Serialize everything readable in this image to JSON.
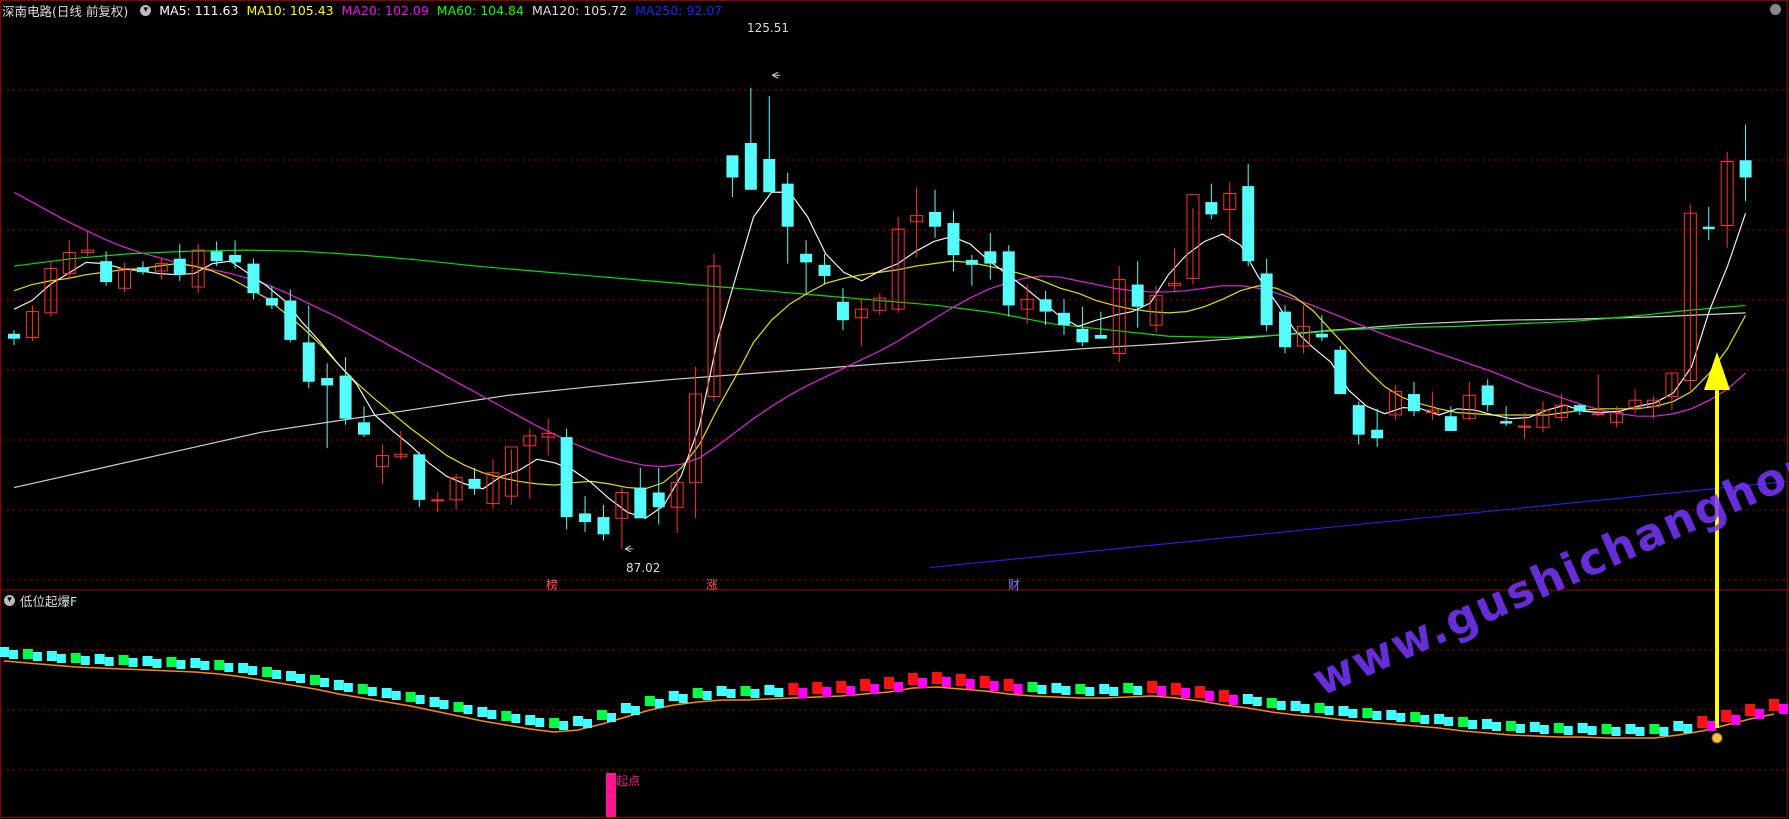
{
  "header": {
    "stock": "深南电路(日线 前复权)",
    "ma": [
      {
        "label": "MA5: 111.63",
        "color": "#ffffff"
      },
      {
        "label": "MA10: 105.43",
        "color": "#ffff00"
      },
      {
        "label": "MA20: 102.09",
        "color": "#ff00ff"
      },
      {
        "label": "MA60: 104.84",
        "color": "#00ff00"
      },
      {
        "label": "MA120: 105.72",
        "color": "#dddddd"
      },
      {
        "label": "MA250: 92.07",
        "color": "#0000ff"
      }
    ]
  },
  "sub_panel": {
    "title": "低位起爆F"
  },
  "markers": {
    "max_label": "125.51",
    "min_label": "87.02",
    "bang_label": "榜",
    "zhang_label": "涨",
    "cai_label": "财",
    "qi_label": "起点"
  },
  "watermark": "www.gushichanghong.com",
  "colors": {
    "up": "#ff3030",
    "down": "#54fcfc",
    "grid": "#8b0000",
    "arrow": "#ffff00"
  },
  "chart_data": {
    "type": "candlestick",
    "ylim": [
      84,
      130
    ],
    "max_price": 125.51,
    "min_price": 87.02,
    "candles": [
      [
        104.5,
        104.8,
        103.6,
        104.1
      ],
      [
        104.2,
        106.8,
        103.9,
        106.3
      ],
      [
        106.2,
        110.3,
        105.9,
        109.8
      ],
      [
        109.4,
        112.1,
        108.9,
        111.1
      ],
      [
        111.1,
        112.8,
        110.8,
        111.3
      ],
      [
        110.4,
        111.2,
        108.4,
        108.7
      ],
      [
        108.2,
        110.3,
        107.9,
        109.8
      ],
      [
        109.9,
        110.4,
        109.3,
        109.5
      ],
      [
        109.6,
        110.6,
        108.9,
        110.2
      ],
      [
        110.6,
        111.8,
        108.8,
        109.3
      ],
      [
        108.3,
        111.8,
        107.8,
        111.3
      ],
      [
        111.2,
        112.0,
        110.0,
        110.4
      ],
      [
        110.9,
        112.1,
        109.8,
        110.3
      ],
      [
        110.2,
        110.6,
        107.3,
        107.8
      ],
      [
        107.4,
        108.4,
        106.5,
        106.8
      ],
      [
        107.2,
        108.1,
        103.8,
        104.0
      ],
      [
        103.8,
        106.8,
        100.1,
        100.6
      ],
      [
        100.9,
        102.1,
        95.2,
        100.3
      ],
      [
        101.1,
        102.6,
        97.1,
        97.6
      ],
      [
        97.3,
        98.6,
        96.1,
        96.3
      ],
      [
        93.7,
        95.5,
        92.3,
        94.6
      ],
      [
        94.5,
        96.6,
        94.3,
        94.7
      ],
      [
        94.7,
        94.9,
        90.4,
        91.0
      ],
      [
        91.0,
        91.6,
        90.0,
        91.0
      ],
      [
        91.0,
        93.1,
        90.2,
        92.8
      ],
      [
        92.7,
        93.6,
        91.4,
        91.9
      ],
      [
        90.7,
        94.3,
        90.3,
        93.2
      ],
      [
        91.3,
        95.1,
        90.6,
        95.3
      ],
      [
        95.4,
        96.8,
        91.1,
        96.2
      ],
      [
        96.1,
        97.6,
        94.6,
        96.4
      ],
      [
        96.1,
        96.8,
        88.6,
        89.6
      ],
      [
        89.9,
        91.3,
        88.4,
        89.2
      ],
      [
        89.6,
        90.6,
        87.7,
        88.2
      ],
      [
        89.5,
        92.0,
        87.0,
        91.6
      ],
      [
        92.0,
        93.6,
        90.2,
        89.5
      ],
      [
        91.6,
        93.6,
        89.0,
        90.4
      ],
      [
        90.4,
        93.3,
        88.3,
        92.4
      ],
      [
        92.4,
        101.8,
        89.5,
        99.6
      ],
      [
        99.4,
        111.0,
        99.0,
        110.0
      ],
      [
        119.0,
        118.6,
        115.6,
        117.2
      ],
      [
        120.0,
        124.5,
        118.9,
        116.2
      ],
      [
        118.7,
        123.8,
        116.1,
        116.0
      ],
      [
        116.7,
        117.6,
        110.2,
        113.2
      ],
      [
        111.0,
        112.1,
        107.8,
        110.3
      ],
      [
        110.1,
        111.0,
        108.5,
        109.2
      ],
      [
        107.1,
        108.2,
        104.8,
        105.6
      ],
      [
        105.8,
        107.3,
        103.5,
        106.5
      ],
      [
        106.4,
        107.8,
        106.0,
        107.4
      ],
      [
        106.5,
        114.0,
        106.2,
        113.0
      ],
      [
        113.6,
        116.4,
        110.7,
        114.1
      ],
      [
        114.4,
        116.2,
        112.3,
        113.2
      ],
      [
        113.5,
        114.5,
        109.6,
        110.9
      ],
      [
        110.5,
        110.9,
        108.4,
        110.1
      ],
      [
        111.2,
        112.7,
        108.9,
        110.2
      ],
      [
        111.2,
        111.7,
        105.9,
        106.8
      ],
      [
        106.5,
        108.5,
        105.3,
        107.3
      ],
      [
        107.3,
        108.0,
        105.2,
        106.3
      ],
      [
        106.2,
        107.3,
        104.4,
        105.2
      ],
      [
        104.9,
        106.7,
        103.5,
        103.8
      ],
      [
        104.4,
        106.3,
        104.2,
        104.1
      ],
      [
        102.9,
        110.0,
        102.2,
        108.9
      ],
      [
        108.5,
        110.4,
        105.0,
        106.7
      ],
      [
        105.2,
        108.4,
        104.6,
        107.6
      ],
      [
        108.4,
        111.5,
        108.0,
        108.6
      ],
      [
        109.0,
        114.7,
        108.5,
        115.8
      ],
      [
        115.2,
        116.7,
        113.8,
        114.2
      ],
      [
        114.6,
        116.8,
        112.0,
        115.9
      ],
      [
        116.5,
        118.3,
        110.0,
        110.4
      ],
      [
        109.4,
        110.6,
        104.7,
        105.2
      ],
      [
        106.3,
        106.8,
        102.9,
        103.4
      ],
      [
        103.5,
        106.8,
        102.9,
        105.1
      ],
      [
        104.5,
        106.0,
        103.9,
        104.2
      ],
      [
        103.2,
        103.5,
        100.4,
        99.6
      ],
      [
        98.7,
        99.0,
        95.5,
        96.3
      ],
      [
        96.7,
        98.4,
        95.3,
        96.0
      ],
      [
        97.9,
        100.3,
        97.5,
        99.8
      ],
      [
        99.6,
        100.6,
        97.8,
        98.2
      ],
      [
        98.1,
        99.8,
        97.5,
        98.3
      ],
      [
        97.8,
        98.6,
        96.6,
        96.6
      ],
      [
        97.6,
        100.6,
        97.5,
        99.5
      ],
      [
        100.3,
        100.8,
        98.2,
        98.7
      ],
      [
        97.4,
        98.6,
        97.0,
        97.2
      ],
      [
        96.9,
        98.1,
        96.0,
        97.0
      ],
      [
        96.9,
        99.0,
        96.5,
        98.3
      ],
      [
        97.7,
        99.6,
        97.4,
        98.7
      ],
      [
        98.7,
        98.8,
        97.9,
        98.2
      ],
      [
        98.0,
        101.2,
        97.8,
        98.0
      ],
      [
        97.3,
        98.6,
        96.9,
        98.1
      ],
      [
        98.5,
        100.0,
        98.0,
        99.1
      ],
      [
        98.6,
        99.4,
        97.6,
        99.1
      ],
      [
        99.4,
        101.3,
        98.3,
        101.3
      ],
      [
        100.7,
        115.0,
        99.7,
        114.3
      ],
      [
        113.2,
        114.8,
        112.1,
        113.0
      ],
      [
        113.3,
        119.3,
        111.5,
        118.5
      ],
      [
        118.6,
        121.5,
        115.3,
        117.2
      ]
    ],
    "ma": {
      "MA5": [
        106.5,
        107.2,
        108.5,
        109.4,
        110.3,
        110.2,
        109.8,
        109.6,
        109.4,
        109.3,
        109.4,
        110.2,
        110.4,
        109.4,
        108.4,
        107.2,
        105.4,
        103.8,
        102.0,
        100.4,
        97.9,
        96.6,
        95.4,
        94.0,
        92.9,
        92.3,
        91.9,
        92.9,
        93.4,
        94.3,
        94.0,
        93.4,
        92.4,
        91.1,
        90.0,
        89.5,
        90.5,
        93.0,
        97.0,
        104.0,
        109.0,
        114.0,
        116.0,
        116.0,
        114.0,
        111.0,
        109.5,
        108.8,
        109.6,
        110.2,
        111.2,
        112.0,
        112.4,
        111.8,
        110.5,
        109.4,
        108.3,
        107.1,
        105.9,
        105.1,
        105.6,
        106.0,
        106.3,
        107.0,
        109.3,
        110.9,
        112.0,
        112.6,
        111.7,
        109.1,
        107.0,
        104.8,
        103.4,
        102.2,
        99.9,
        98.6,
        98.0,
        98.5,
        98.4,
        97.9,
        98.4,
        98.3,
        97.9,
        97.6,
        97.7,
        98.3,
        98.7,
        98.2,
        98.1,
        98.2,
        98.6,
        98.9,
        99.7,
        101.8,
        106.4,
        110.0,
        114.3
      ],
      "MA10": [
        108.0,
        108.5,
        108.8,
        109.0,
        109.3,
        109.5,
        109.7,
        109.8,
        110.0,
        110.2,
        110.0,
        109.6,
        109.0,
        108.2,
        107.4,
        106.2,
        105.0,
        103.6,
        102.0,
        100.5,
        99.2,
        98.0,
        96.8,
        95.7,
        94.6,
        93.8,
        93.2,
        92.8,
        92.5,
        92.3,
        92.2,
        92.4,
        92.5,
        92.3,
        92.0,
        91.9,
        92.4,
        93.6,
        95.5,
        98.4,
        101.0,
        103.8,
        105.6,
        106.9,
        107.8,
        108.6,
        109.0,
        109.3,
        109.5,
        109.7,
        110.0,
        110.2,
        110.4,
        110.3,
        110.0,
        109.7,
        109.3,
        108.8,
        108.2,
        107.8,
        107.2,
        106.8,
        106.5,
        106.3,
        106.2,
        106.3,
        106.7,
        107.3,
        108.0,
        108.4,
        108.2,
        107.5,
        106.4,
        104.8,
        103.2,
        101.6,
        100.2,
        99.3,
        98.8,
        98.4,
        98.1,
        98.0,
        97.9,
        97.9,
        97.9,
        97.9,
        98.1,
        98.3,
        98.4,
        98.4,
        98.4,
        98.6,
        99.0,
        99.8,
        101.3,
        103.3,
        106.0
      ],
      "MA20": [
        116.0,
        115.2,
        114.4,
        113.6,
        112.9,
        112.2,
        111.6,
        111.1,
        110.7,
        110.3,
        110.0,
        109.7,
        109.4,
        109.0,
        108.5,
        107.9,
        107.2,
        106.5,
        105.8,
        105.0,
        104.2,
        103.4,
        102.6,
        101.8,
        101.0,
        100.2,
        99.4,
        98.6,
        97.8,
        97.0,
        96.3,
        95.6,
        95.0,
        94.5,
        94.1,
        93.8,
        93.7,
        93.9,
        94.4,
        95.4,
        96.5,
        97.6,
        98.6,
        99.5,
        100.3,
        101.0,
        101.7,
        102.4,
        103.1,
        103.9,
        104.8,
        105.7,
        106.6,
        107.4,
        108.1,
        108.6,
        109.0,
        109.2,
        109.1,
        108.8,
        108.5,
        108.2,
        108.0,
        107.9,
        107.9,
        108.0,
        108.2,
        108.4,
        108.4,
        108.2,
        107.8,
        107.3,
        106.8,
        106.2,
        105.6,
        105.0,
        104.4,
        103.9,
        103.4,
        102.9,
        102.4,
        101.9,
        101.4,
        100.8,
        100.2,
        99.7,
        99.2,
        98.7,
        98.3,
        98.0,
        97.8,
        97.8,
        98.0,
        98.4,
        99.1,
        100.0,
        101.3
      ]
    }
  }
}
